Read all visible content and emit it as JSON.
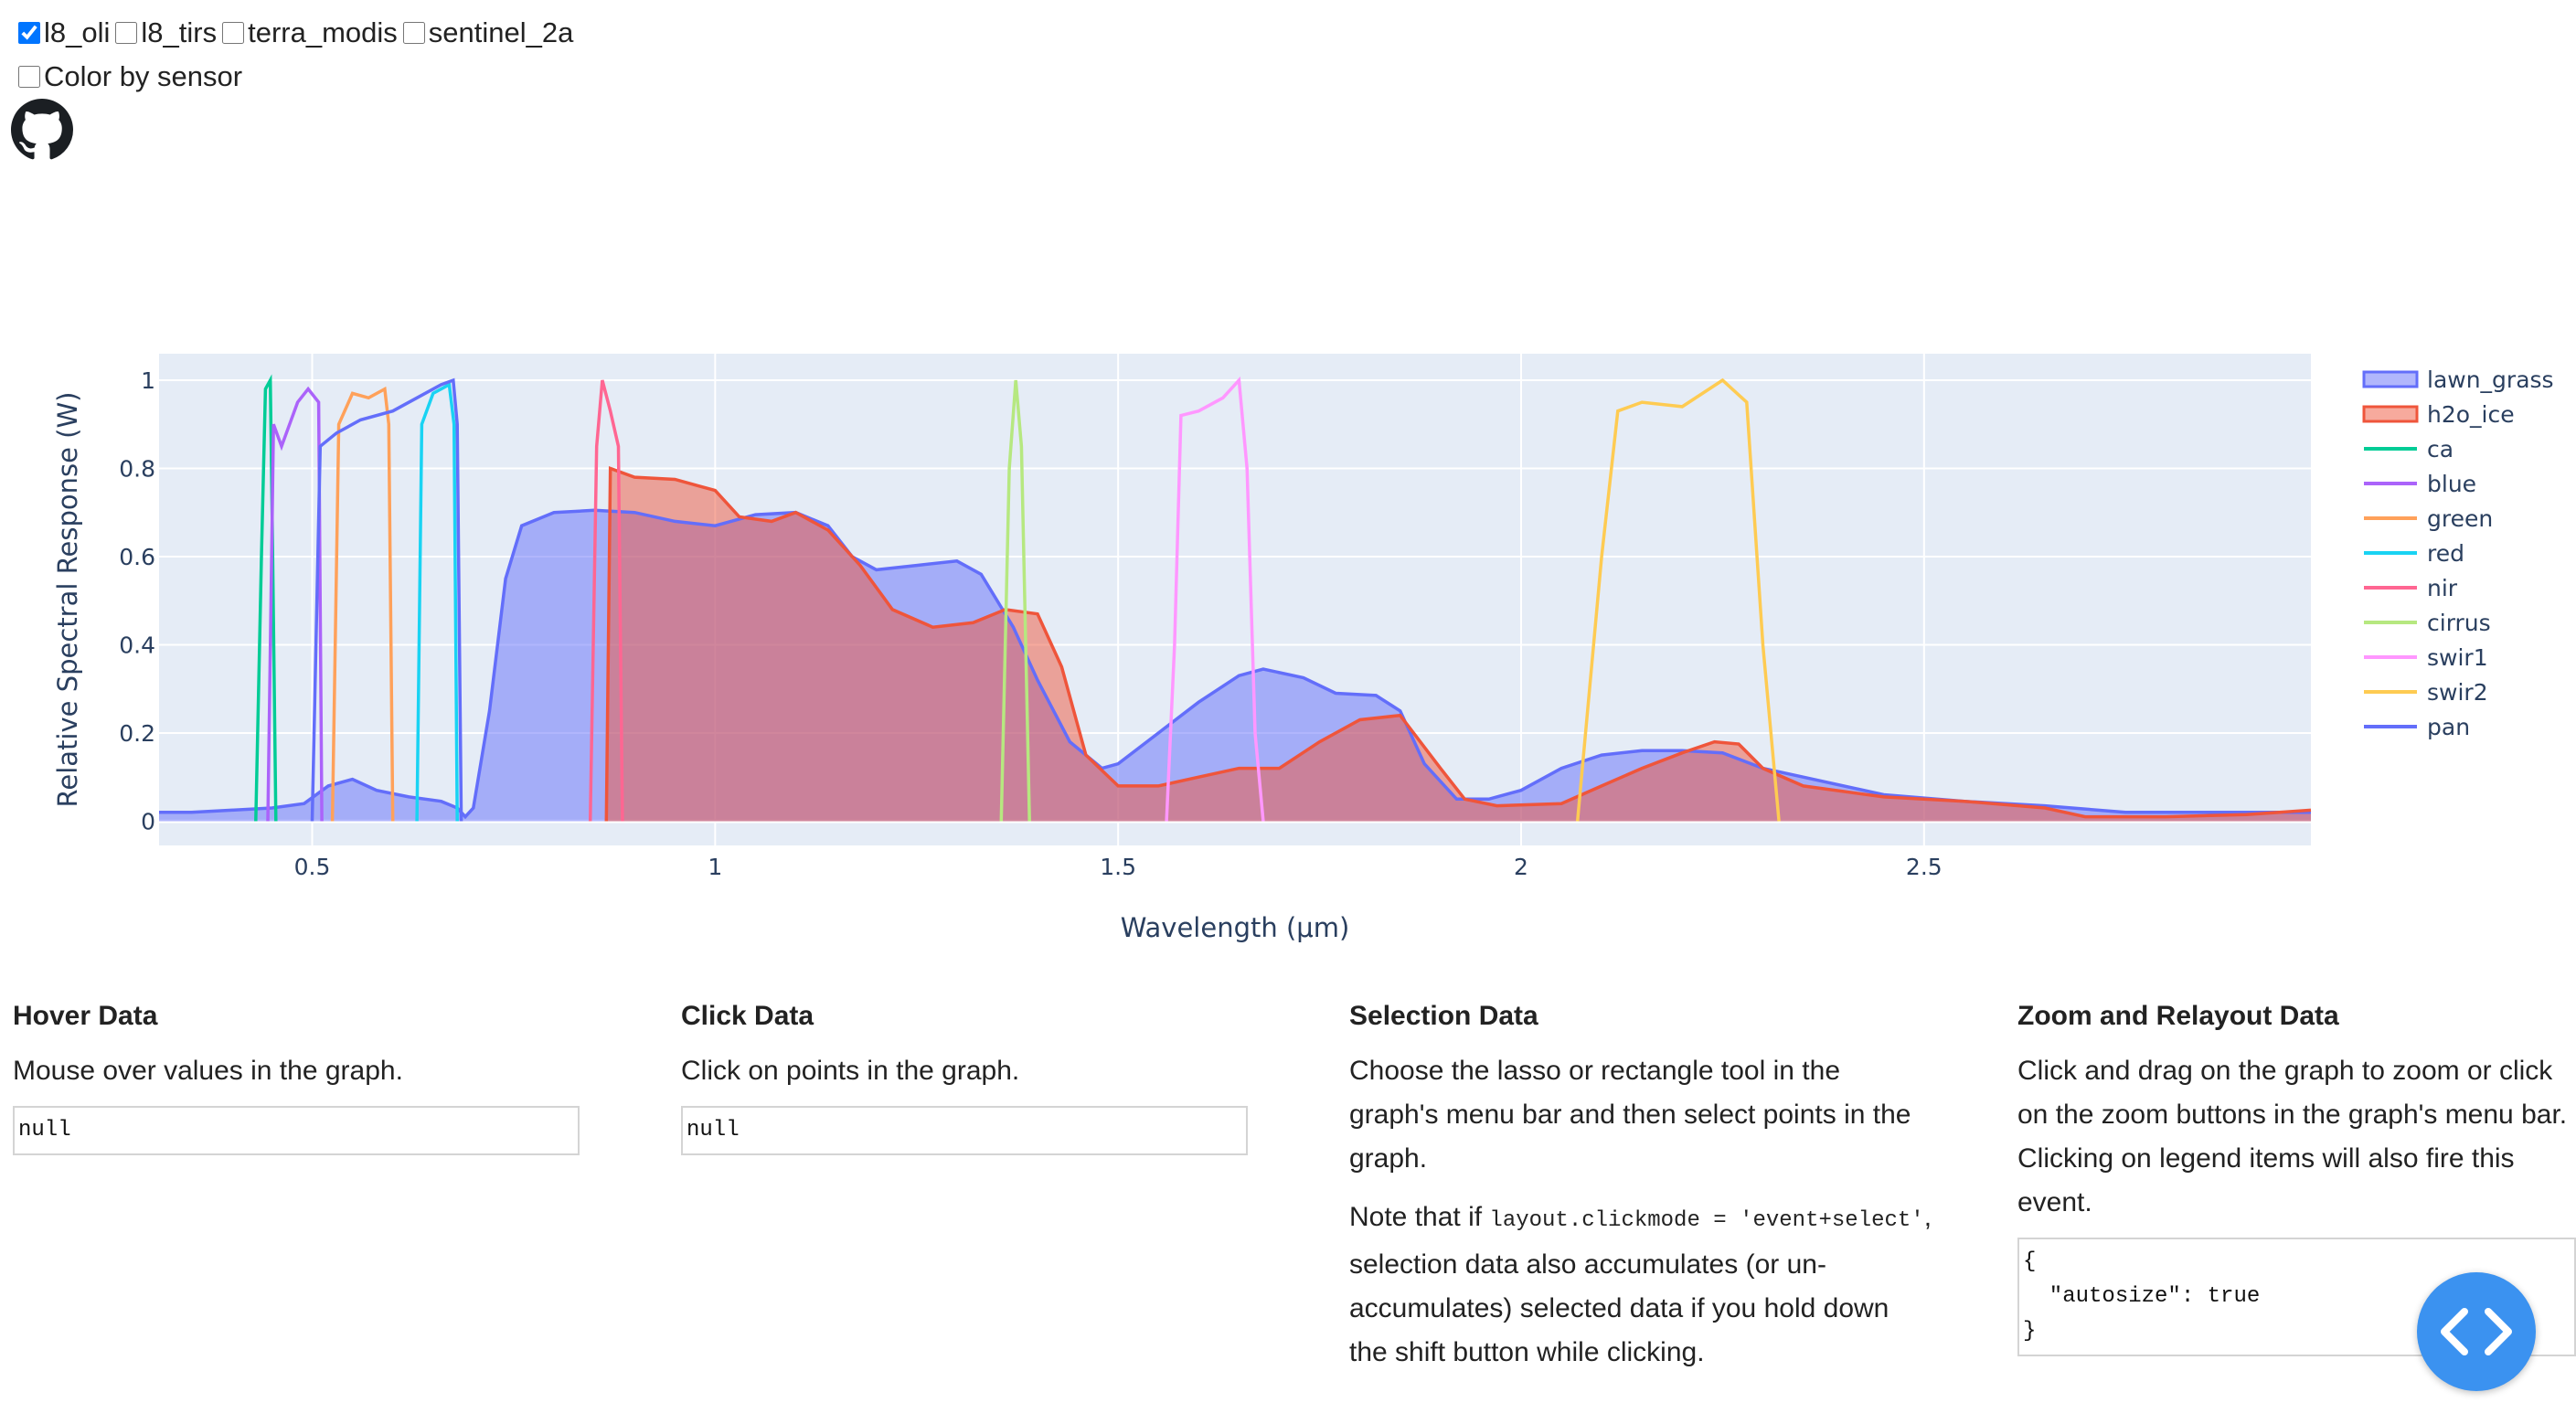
{
  "controls": {
    "sensors": [
      {
        "label": "l8_oli",
        "checked": true
      },
      {
        "label": "l8_tirs",
        "checked": false
      },
      {
        "label": "terra_modis",
        "checked": false
      },
      {
        "label": "sentinel_2a",
        "checked": false
      }
    ],
    "color_by_sensor": {
      "label": "Color by sensor",
      "checked": false
    }
  },
  "chart_data": {
    "type": "area",
    "xlabel": "Wavelength (μm)",
    "ylabel": "Relative Spectral Response (W)",
    "xlim": [
      0.31,
      2.98
    ],
    "ylim": [
      -0.055,
      1.06
    ],
    "xticks": [
      {
        "v": 0.5,
        "label": "0.5"
      },
      {
        "v": 1,
        "label": "1"
      },
      {
        "v": 1.5,
        "label": "1.5"
      },
      {
        "v": 2,
        "label": "2"
      },
      {
        "v": 2.5,
        "label": "2.5"
      }
    ],
    "yticks": [
      {
        "v": 0,
        "label": "0"
      },
      {
        "v": 0.2,
        "label": "0.2"
      },
      {
        "v": 0.4,
        "label": "0.4"
      },
      {
        "v": 0.6,
        "label": "0.6"
      },
      {
        "v": 0.8,
        "label": "0.8"
      },
      {
        "v": 1,
        "label": "1"
      }
    ],
    "grid": true,
    "legend_position": "right",
    "series": [
      {
        "name": "lawn_grass",
        "color": "#636efa",
        "fill": true,
        "points": [
          [
            0.31,
            0.02
          ],
          [
            0.35,
            0.02
          ],
          [
            0.4,
            0.025
          ],
          [
            0.45,
            0.03
          ],
          [
            0.49,
            0.04
          ],
          [
            0.52,
            0.08
          ],
          [
            0.55,
            0.095
          ],
          [
            0.58,
            0.07
          ],
          [
            0.62,
            0.055
          ],
          [
            0.66,
            0.045
          ],
          [
            0.68,
            0.03
          ],
          [
            0.69,
            0.01
          ],
          [
            0.7,
            0.03
          ],
          [
            0.72,
            0.25
          ],
          [
            0.74,
            0.55
          ],
          [
            0.76,
            0.67
          ],
          [
            0.8,
            0.7
          ],
          [
            0.85,
            0.705
          ],
          [
            0.9,
            0.7
          ],
          [
            0.95,
            0.68
          ],
          [
            1.0,
            0.67
          ],
          [
            1.05,
            0.695
          ],
          [
            1.1,
            0.7
          ],
          [
            1.14,
            0.67
          ],
          [
            1.17,
            0.6
          ],
          [
            1.2,
            0.57
          ],
          [
            1.25,
            0.58
          ],
          [
            1.3,
            0.59
          ],
          [
            1.33,
            0.56
          ],
          [
            1.37,
            0.44
          ],
          [
            1.4,
            0.32
          ],
          [
            1.44,
            0.18
          ],
          [
            1.48,
            0.12
          ],
          [
            1.5,
            0.13
          ],
          [
            1.55,
            0.2
          ],
          [
            1.6,
            0.27
          ],
          [
            1.65,
            0.33
          ],
          [
            1.68,
            0.345
          ],
          [
            1.73,
            0.325
          ],
          [
            1.77,
            0.29
          ],
          [
            1.82,
            0.285
          ],
          [
            1.85,
            0.25
          ],
          [
            1.88,
            0.13
          ],
          [
            1.92,
            0.05
          ],
          [
            1.96,
            0.05
          ],
          [
            2.0,
            0.07
          ],
          [
            2.05,
            0.12
          ],
          [
            2.1,
            0.15
          ],
          [
            2.15,
            0.16
          ],
          [
            2.2,
            0.16
          ],
          [
            2.25,
            0.155
          ],
          [
            2.3,
            0.12
          ],
          [
            2.35,
            0.1
          ],
          [
            2.45,
            0.06
          ],
          [
            2.55,
            0.045
          ],
          [
            2.65,
            0.035
          ],
          [
            2.75,
            0.02
          ],
          [
            2.85,
            0.02
          ],
          [
            2.98,
            0.02
          ]
        ]
      },
      {
        "name": "h2o_ice",
        "color": "#ef553b",
        "fill": true,
        "points": [
          [
            0.865,
            0
          ],
          [
            0.87,
            0.8
          ],
          [
            0.9,
            0.78
          ],
          [
            0.95,
            0.775
          ],
          [
            1.0,
            0.75
          ],
          [
            1.03,
            0.69
          ],
          [
            1.07,
            0.68
          ],
          [
            1.1,
            0.7
          ],
          [
            1.14,
            0.66
          ],
          [
            1.18,
            0.58
          ],
          [
            1.22,
            0.48
          ],
          [
            1.27,
            0.44
          ],
          [
            1.32,
            0.45
          ],
          [
            1.36,
            0.48
          ],
          [
            1.4,
            0.47
          ],
          [
            1.43,
            0.35
          ],
          [
            1.46,
            0.15
          ],
          [
            1.5,
            0.08
          ],
          [
            1.55,
            0.08
          ],
          [
            1.6,
            0.1
          ],
          [
            1.65,
            0.12
          ],
          [
            1.7,
            0.12
          ],
          [
            1.75,
            0.18
          ],
          [
            1.8,
            0.23
          ],
          [
            1.85,
            0.24
          ],
          [
            1.9,
            0.12
          ],
          [
            1.93,
            0.05
          ],
          [
            1.97,
            0.035
          ],
          [
            2.05,
            0.04
          ],
          [
            2.1,
            0.08
          ],
          [
            2.15,
            0.12
          ],
          [
            2.2,
            0.155
          ],
          [
            2.24,
            0.18
          ],
          [
            2.27,
            0.175
          ],
          [
            2.3,
            0.12
          ],
          [
            2.35,
            0.08
          ],
          [
            2.45,
            0.055
          ],
          [
            2.55,
            0.045
          ],
          [
            2.65,
            0.03
          ],
          [
            2.7,
            0.01
          ],
          [
            2.8,
            0.01
          ],
          [
            2.9,
            0.015
          ],
          [
            2.98,
            0.025
          ]
        ]
      },
      {
        "name": "ca",
        "color": "#00cc96",
        "fill": false,
        "points": [
          [
            0.43,
            0
          ],
          [
            0.437,
            0.6
          ],
          [
            0.442,
            0.98
          ],
          [
            0.448,
            1.0
          ],
          [
            0.451,
            0.6
          ],
          [
            0.455,
            0
          ]
        ]
      },
      {
        "name": "blue",
        "color": "#ab63fa",
        "fill": false,
        "points": [
          [
            0.445,
            0
          ],
          [
            0.452,
            0.9
          ],
          [
            0.462,
            0.85
          ],
          [
            0.472,
            0.9
          ],
          [
            0.482,
            0.95
          ],
          [
            0.495,
            0.98
          ],
          [
            0.508,
            0.95
          ],
          [
            0.512,
            0
          ]
        ]
      },
      {
        "name": "green",
        "color": "#ffa15a",
        "fill": false,
        "points": [
          [
            0.525,
            0
          ],
          [
            0.533,
            0.9
          ],
          [
            0.55,
            0.97
          ],
          [
            0.57,
            0.96
          ],
          [
            0.59,
            0.98
          ],
          [
            0.595,
            0.9
          ],
          [
            0.6,
            0
          ]
        ]
      },
      {
        "name": "red",
        "color": "#19d3f3",
        "fill": false,
        "points": [
          [
            0.63,
            0
          ],
          [
            0.636,
            0.9
          ],
          [
            0.65,
            0.97
          ],
          [
            0.67,
            0.99
          ],
          [
            0.676,
            0.9
          ],
          [
            0.68,
            0
          ]
        ]
      },
      {
        "name": "nir",
        "color": "#ff6692",
        "fill": false,
        "points": [
          [
            0.845,
            0
          ],
          [
            0.853,
            0.85
          ],
          [
            0.86,
            1.0
          ],
          [
            0.87,
            0.93
          ],
          [
            0.88,
            0.85
          ],
          [
            0.885,
            0
          ]
        ]
      },
      {
        "name": "cirrus",
        "color": "#b6e880",
        "fill": false,
        "points": [
          [
            1.355,
            0
          ],
          [
            1.365,
            0.8
          ],
          [
            1.373,
            1.0
          ],
          [
            1.38,
            0.85
          ],
          [
            1.39,
            0
          ]
        ]
      },
      {
        "name": "swir1",
        "color": "#ff97ff",
        "fill": false,
        "points": [
          [
            1.56,
            0
          ],
          [
            1.57,
            0.4
          ],
          [
            1.578,
            0.92
          ],
          [
            1.6,
            0.93
          ],
          [
            1.63,
            0.96
          ],
          [
            1.65,
            1.0
          ],
          [
            1.66,
            0.8
          ],
          [
            1.67,
            0.2
          ],
          [
            1.68,
            0
          ]
        ]
      },
      {
        "name": "swir2",
        "color": "#fecb52",
        "fill": false,
        "points": [
          [
            2.07,
            0
          ],
          [
            2.1,
            0.6
          ],
          [
            2.12,
            0.93
          ],
          [
            2.15,
            0.95
          ],
          [
            2.2,
            0.94
          ],
          [
            2.25,
            1.0
          ],
          [
            2.28,
            0.95
          ],
          [
            2.3,
            0.4
          ],
          [
            2.32,
            0
          ]
        ]
      },
      {
        "name": "pan",
        "color": "#636efa",
        "fill": false,
        "points": [
          [
            0.5,
            0
          ],
          [
            0.51,
            0.85
          ],
          [
            0.53,
            0.88
          ],
          [
            0.56,
            0.91
          ],
          [
            0.6,
            0.93
          ],
          [
            0.63,
            0.96
          ],
          [
            0.66,
            0.99
          ],
          [
            0.675,
            1.0
          ],
          [
            0.68,
            0.9
          ],
          [
            0.685,
            0
          ]
        ]
      }
    ]
  },
  "panels": {
    "hover": {
      "title": "Hover Data",
      "text": "Mouse over values in the graph.",
      "value": "null"
    },
    "click": {
      "title": "Click Data",
      "text": "Click on points in the graph.",
      "value": "null"
    },
    "selection": {
      "title": "Selection Data",
      "text": "Choose the lasso or rectangle tool in the graph's menu bar and then select points in the graph.",
      "note_prefix": "Note that if ",
      "note_code": "layout.clickmode = 'event+select'",
      "note_suffix": ", selection data also accumulates (or un-accumulates) selected data if you hold down the shift button while clicking."
    },
    "relayout": {
      "title": "Zoom and Relayout Data",
      "text": "Click and drag on the graph to zoom or click on the zoom buttons in the graph's menu bar. Clicking on legend items will also fire this event.",
      "value": "{\n  \"autosize\": true\n}"
    }
  },
  "fab_icon": "code-icon"
}
